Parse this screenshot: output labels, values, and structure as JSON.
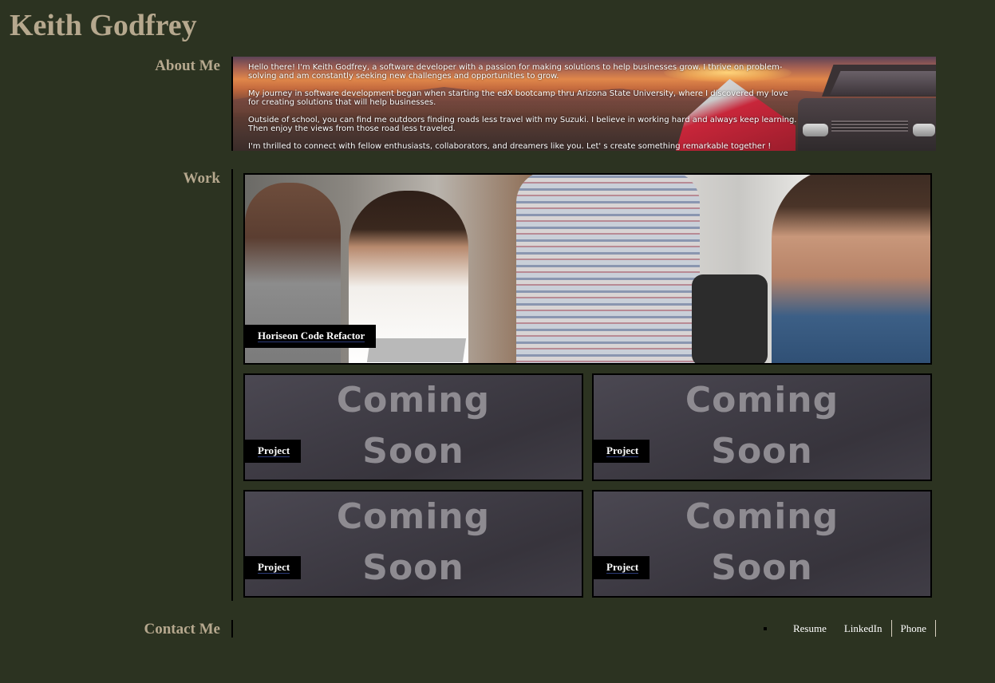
{
  "header": {
    "title": "Keith Godfrey"
  },
  "about": {
    "label": "About Me",
    "paragraphs": [
      "Hello there! I'm Keith Godfrey, a software developer with a passion for making solutions to help businesses grow. I thrive on problem-solving and am constantly seeking new challenges and opportunities to grow.",
      "My journey in software development began when starting the edX bootcamp thru Arizona State University, where I discovered my love for creating solutions that will help businesses.",
      "Outside of school, you can find me outdoors finding roads less travel with my Suzuki. I believe in working hard and always keep learning. Then enjoy the views from those road less traveled.",
      "I'm thrilled to connect with fellow enthusiasts, collaborators, and dreamers like you. Let' s create something remarkable together !"
    ]
  },
  "work": {
    "label": "Work",
    "featured": {
      "title": "Horiseon Code Refactor"
    },
    "projects": [
      {
        "title": "Project",
        "image_text_top": "Coming",
        "image_text_bottom": "Soon"
      },
      {
        "title": "Project",
        "image_text_top": "Coming",
        "image_text_bottom": "Soon"
      },
      {
        "title": "Project",
        "image_text_top": "Coming",
        "image_text_bottom": "Soon"
      },
      {
        "title": "Project",
        "image_text_top": "Coming",
        "image_text_bottom": "Soon"
      }
    ]
  },
  "contact": {
    "label": "Contact Me",
    "links": [
      "Resume",
      "LinkedIn",
      "Phone"
    ]
  },
  "colors": {
    "background": "#2c3321",
    "heading": "#b6a88e",
    "label_bg": "#000000"
  }
}
